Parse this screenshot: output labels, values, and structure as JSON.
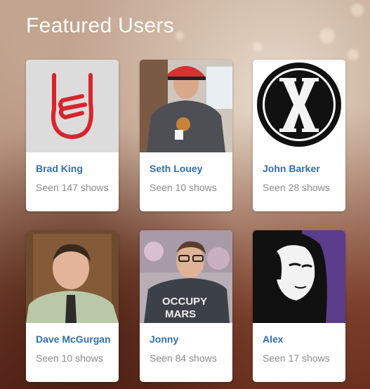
{
  "page": {
    "title": "Featured Users"
  },
  "users": [
    {
      "name": "Brad King",
      "seen": "Seen 147 shows",
      "photo": "rock-hand-icon"
    },
    {
      "name": "Seth Louey",
      "seen": "Seen 10 shows",
      "photo": "user-photo"
    },
    {
      "name": "John Barker",
      "seen": "Seen 28 shows",
      "photo": "x-files-logo"
    },
    {
      "name": "Dave McGurgan",
      "seen": "Seen 10 shows",
      "photo": "user-photo"
    },
    {
      "name": "Jonny",
      "seen": "Seen 84 shows",
      "photo": "user-photo",
      "shirt_text": [
        "OCCUPY",
        "MARS"
      ]
    },
    {
      "name": "Alex",
      "seen": "Seen 17 shows",
      "photo": "comic-illustration"
    }
  ],
  "colors": {
    "link": "#2f6fae",
    "muted": "#8a8a8a",
    "rock_hand": "#d9242c"
  }
}
